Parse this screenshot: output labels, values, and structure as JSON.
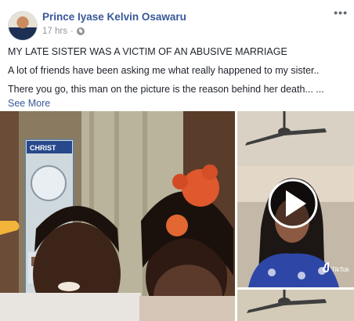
{
  "post": {
    "author": "Prince Iyase Kelvin Osawaru",
    "time": "17 hrs",
    "menu_label": "•••",
    "title": "MY LATE SISTER WAS A VICTIM OF AN ABUSIVE MARRIAGE",
    "paragraph1": "A lot of friends have been asking me what really happened to my sister..",
    "paragraph2": "There you go, this man on the picture is the reason behind her death... ...",
    "see_more": "See More"
  },
  "media": {
    "left_photo_sign": "CHRIST",
    "video_badge": "TikTok",
    "icons": [
      "privacy-globe-icon",
      "play-icon",
      "tiktok-logo-icon",
      "more-options-icon"
    ]
  }
}
